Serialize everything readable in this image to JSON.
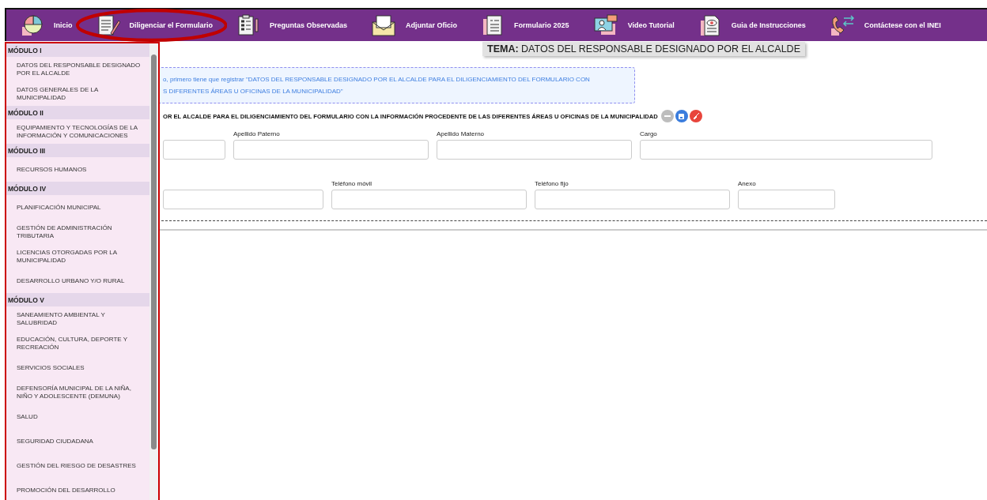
{
  "nav": {
    "items": [
      {
        "label": "Inicio",
        "highlighted": false
      },
      {
        "label": "Diligenciar el Formulario",
        "highlighted": true
      },
      {
        "label": "Preguntas Observadas",
        "highlighted": false
      },
      {
        "label": "Adjuntar Oficio",
        "highlighted": false
      },
      {
        "label": "Formulario 2025",
        "highlighted": false
      },
      {
        "label": "Video Tutorial",
        "highlighted": false
      },
      {
        "label": "Guia de Instrucciones",
        "highlighted": false
      },
      {
        "label": "Contáctese con el INEI",
        "highlighted": false
      }
    ]
  },
  "sidebar": {
    "modules": [
      {
        "title": "MÓDULO I",
        "items": [
          "DATOS DEL RESPONSABLE DESIGNADO POR EL ALCALDE",
          "DATOS GENERALES DE LA MUNICIPALIDAD"
        ]
      },
      {
        "title": "MÓDULO II",
        "items": [
          "EQUIPAMIENTO Y TECNOLOGÍAS DE LA INFORMACIÓN Y COMUNICACIONES"
        ]
      },
      {
        "title": "MÓDULO III",
        "items": [
          "RECURSOS HUMANOS"
        ]
      },
      {
        "title": "MÓDULO IV",
        "items": [
          "PLANIFICACIÓN MUNICIPAL",
          "GESTIÓN DE ADMINISTRACIÓN TRIBUTARIA",
          "LICENCIAS OTORGADAS POR LA MUNICIPALIDAD",
          "DESARROLLO URBANO Y/O RURAL"
        ]
      },
      {
        "title": "MÓDULO V",
        "items": [
          "SANEAMIENTO AMBIENTAL Y SALUBRIDAD",
          "EDUCACIÓN, CULTURA, DEPORTE Y RECREACIÓN",
          "SERVICIOS SOCIALES",
          "DEFENSORÍA MUNICIPAL DE LA NIÑA, NIÑO Y ADOLESCENTE (DEMUNA)",
          "SALUD",
          "SEGURIDAD CIUDADANA",
          "GESTIÓN DEL RIESGO DE DESASTRES",
          "PROMOCIÓN DEL DESARROLLO"
        ]
      }
    ]
  },
  "main": {
    "title": {
      "prefix": "TEMA:",
      "text": "DATOS DEL RESPONSABLE DESIGNADO POR EL ALCALDE"
    },
    "notice": [
      "o, primero tiene que registrar \"DATOS DEL RESPONSABLE DESIGNADO POR EL ALCALDE PARA EL DILIGENCIAMIENTO DEL FORMULARIO CON",
      "S DIFERENTES ÁREAS U OFICINAS DE LA MUNICIPALIDAD\""
    ],
    "section": "OR EL ALCALDE PARA EL DILIGENCIAMIENTO DEL FORMULARIO CON LA INFORMACIÓN PROCEDENTE DE LAS DIFERENTES ÁREAS U OFICINAS DE LA MUNICIPALIDAD",
    "actions": [
      {
        "kind": "remove"
      },
      {
        "kind": "save"
      },
      {
        "kind": "clear"
      }
    ],
    "rows": [
      [
        {},
        {
          "label": "Apellido Paterno"
        },
        {
          "label": "Apellido Materno"
        },
        {
          "label": "Cargo"
        }
      ],
      [
        {},
        {
          "label": "Teléfono móvil"
        },
        {
          "label": "Teléfono fijo"
        },
        {
          "label": "Anexo"
        }
      ]
    ]
  }
}
